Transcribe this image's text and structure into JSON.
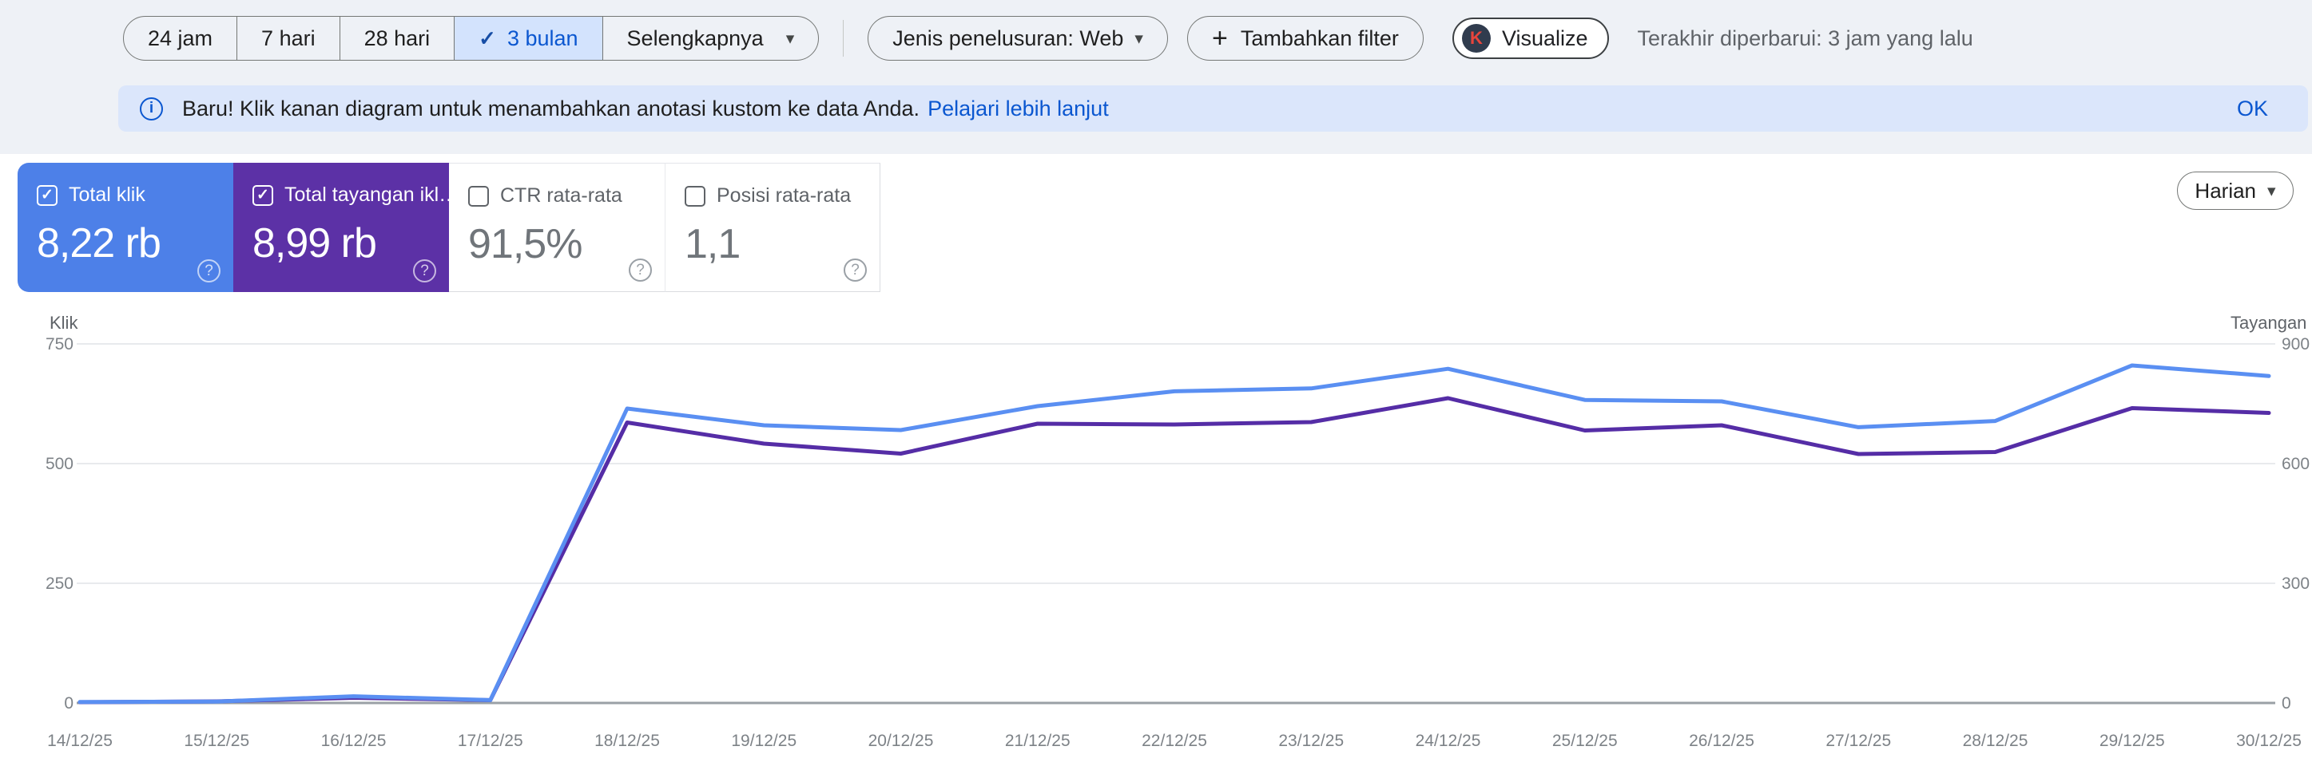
{
  "toolbar": {
    "date_ranges": [
      {
        "label": "24 jam",
        "selected": false
      },
      {
        "label": "7 hari",
        "selected": false
      },
      {
        "label": "28 hari",
        "selected": false
      },
      {
        "label": "3 bulan",
        "selected": true
      },
      {
        "label": "Selengkapnya",
        "selected": false
      }
    ],
    "check_glyph": "✓",
    "caret_glyph": "▾",
    "plus_glyph": "+",
    "search_type_label": "Jenis penelusuran: Web",
    "add_filter_label": "Tambahkan filter",
    "visualize_label": "Visualize",
    "visualize_badge": "K",
    "last_updated": "Terakhir diperbarui: 3 jam yang lalu"
  },
  "banner": {
    "info_glyph": "i",
    "message": "Baru! Klik kanan diagram untuk menambahkan anotasi kustom ke data Anda.",
    "link_label": "Pelajari lebih lanjut",
    "dismiss_label": "OK"
  },
  "metric_cards": [
    {
      "label": "Total klik",
      "value": "8,22 rb",
      "checked": true,
      "bg": "#4d80e8"
    },
    {
      "label": "Total tayangan ikl…",
      "value": "8,99 rb",
      "checked": true,
      "bg": "#5c31a6"
    },
    {
      "label": "CTR rata-rata",
      "value": "91,5%",
      "checked": false,
      "bg": "#ffffff"
    },
    {
      "label": "Posisi rata-rata",
      "value": "1,1",
      "checked": false,
      "bg": "#ffffff"
    }
  ],
  "granularity": {
    "label": "Harian"
  },
  "chart_data": {
    "type": "line",
    "x": [
      "14/12/25",
      "15/12/25",
      "16/12/25",
      "17/12/25",
      "18/12/25",
      "19/12/25",
      "20/12/25",
      "21/12/25",
      "22/12/25",
      "23/12/25",
      "24/12/25",
      "25/12/25",
      "26/12/25",
      "27/12/25",
      "28/12/25",
      "29/12/25",
      "30/12/25"
    ],
    "series": [
      {
        "name": "Total tayangan",
        "axis": "right",
        "color": "#552da6",
        "values": [
          2,
          4,
          13,
          7,
          703,
          650,
          625,
          700,
          698,
          704,
          764,
          683,
          696,
          624,
          629,
          739,
          727
        ]
      },
      {
        "name": "Total klik",
        "axis": "left",
        "color": "#5a8ff2",
        "values": [
          2,
          3,
          14,
          6,
          615,
          580,
          570,
          620,
          651,
          657,
          698,
          633,
          630,
          576,
          589,
          705,
          683
        ]
      }
    ],
    "left_axis": {
      "label": "Klik",
      "ticks": [
        0,
        250,
        500,
        750
      ],
      "max": 750
    },
    "right_axis": {
      "label": "Tayangan",
      "ticks": [
        0,
        300,
        600,
        900
      ],
      "max": 900
    },
    "grid": true,
    "legend_position": "none",
    "colors": {
      "grid": "#e8eaed",
      "baseline": "#9aa0a6",
      "tick_text": "#7d8287",
      "axis_title": "#5f6368"
    }
  }
}
